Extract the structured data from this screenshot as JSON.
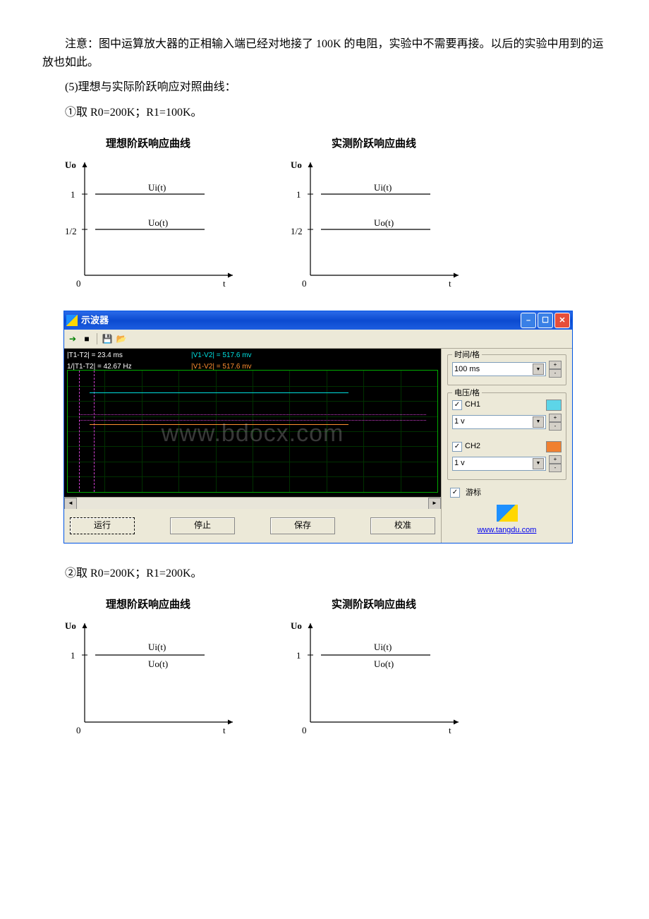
{
  "text": {
    "p1": "注意：图中运算放大器的正相输入端已经对地接了 100K 的电阻，实验中不需要再接。以后的实验中用到的运放也如此。",
    "p2": "(5)理想与实际阶跃响应对照曲线：",
    "p3": "①取 R0=200K；R1=100K。",
    "p4": "②取 R0=200K；R1=200K。"
  },
  "diagram_a": {
    "title_ideal": "理想阶跃响应曲线",
    "title_measured": "实测阶跃响应曲线",
    "y_label": "Uo",
    "x_label": "t",
    "y_ticks": [
      "1",
      "1/2",
      "0"
    ],
    "ui_label": "Ui(t)",
    "uo_label": "Uo(t)"
  },
  "diagram_b": {
    "title_ideal": "理想阶跃响应曲线",
    "title_measured": "实测阶跃响应曲线",
    "y_label": "Uo",
    "x_label": "t",
    "y_ticks": [
      "1",
      "0"
    ],
    "ui_label": "Ui(t)",
    "uo_label": "Uo(t)"
  },
  "osc": {
    "title": "示波器",
    "info": {
      "t_diff": "|T1-T2| = 23.4 ms",
      "t_freq": "1/|T1-T2| = 42.67 Hz",
      "v_diff1": "|V1-V2| = 517.6 mv",
      "v_diff2": "|V1-V2| = 517.6 mv"
    },
    "panel": {
      "time_label": "时间/格",
      "time_value": "100 ms",
      "volt_label": "电压/格",
      "ch1": "CH1",
      "ch2": "CH2",
      "ch1_value": "1 v",
      "ch2_value": "1 v",
      "cursor": "游标"
    },
    "link": "www.tangdu.com",
    "buttons": {
      "run": "运行",
      "stop": "停止",
      "save": "保存",
      "calibrate": "校准"
    },
    "watermark": "www.bdocx.com"
  },
  "chart_data": [
    {
      "type": "line",
      "title": "理想阶跃响应曲线",
      "xlabel": "t",
      "ylabel": "Uo",
      "x": [
        0,
        1
      ],
      "series": [
        {
          "name": "Ui(t)",
          "values": [
            1,
            1
          ]
        },
        {
          "name": "Uo(t)",
          "values": [
            0.5,
            0.5
          ]
        }
      ],
      "ylim": [
        0,
        1.2
      ]
    },
    {
      "type": "line",
      "title": "实测阶跃响应曲线",
      "xlabel": "t",
      "ylabel": "Uo",
      "x": [
        0,
        1
      ],
      "series": [
        {
          "name": "Ui(t)",
          "values": [
            1,
            1
          ]
        },
        {
          "name": "Uo(t)",
          "values": [
            0.5,
            0.5
          ]
        }
      ],
      "ylim": [
        0,
        1.2
      ]
    },
    {
      "type": "line",
      "title": "示波器",
      "xlabel": "100 ms/div",
      "ylabel": "1 v/div",
      "annotations": [
        "|T1-T2| = 23.4 ms",
        "1/|T1-T2| = 42.67 Hz",
        "|V1-V2| = 517.6 mv"
      ],
      "series": [
        {
          "name": "CH1",
          "color": "#00e0e0"
        },
        {
          "name": "CH2",
          "color": "#ff9030"
        }
      ]
    },
    {
      "type": "line",
      "title": "理想阶跃响应曲线",
      "xlabel": "t",
      "ylabel": "Uo",
      "x": [
        0,
        1
      ],
      "series": [
        {
          "name": "Ui(t)",
          "values": [
            1,
            1
          ]
        },
        {
          "name": "Uo(t)",
          "values": [
            1,
            1
          ]
        }
      ],
      "ylim": [
        0,
        1.2
      ]
    },
    {
      "type": "line",
      "title": "实测阶跃响应曲线",
      "xlabel": "t",
      "ylabel": "Uo",
      "x": [
        0,
        1
      ],
      "series": [
        {
          "name": "Ui(t)",
          "values": [
            1,
            1
          ]
        },
        {
          "name": "Uo(t)",
          "values": [
            1,
            1
          ]
        }
      ],
      "ylim": [
        0,
        1.2
      ]
    }
  ]
}
